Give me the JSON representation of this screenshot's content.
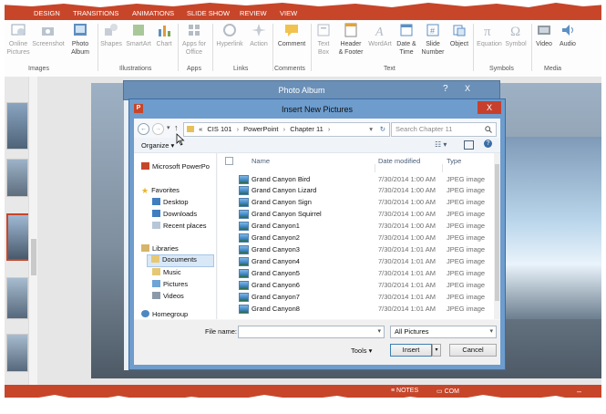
{
  "ribbon": {
    "tabs": [
      "DESIGN",
      "TRANSITIONS",
      "ANIMATIONS",
      "SLIDE SHOW",
      "REVIEW",
      "VIEW"
    ],
    "buttons": {
      "online_pictures": "Online\nPictures",
      "screenshot": "Screenshot",
      "photo_album": "Photo\nAlbum",
      "shapes": "Shapes",
      "smartart": "SmartArt",
      "chart": "Chart",
      "apps_for_office": "Apps for\nOffice",
      "hyperlink": "Hyperlink",
      "action": "Action",
      "comment": "Comment",
      "text_box": "Text\nBox",
      "header_footer": "Header\n& Footer",
      "wordart": "WordArt",
      "date_time": "Date &\nTime",
      "slide_number": "Slide\nNumber",
      "object": "Object",
      "equation": "Equation",
      "symbol": "Symbol",
      "video": "Video",
      "audio": "Audio"
    },
    "groups": {
      "images": "Images",
      "illustrations": "Illustrations",
      "apps": "Apps",
      "links": "Links",
      "comments": "Comments",
      "text": "Text",
      "symbols": "Symbols",
      "media": "Media"
    }
  },
  "status_bar": {
    "notes": "NOTES",
    "comments": "COM"
  },
  "photo_album": {
    "title": "Photo Album",
    "help": "?",
    "close": "X"
  },
  "insert_dialog": {
    "title": "Insert New Pictures",
    "close": "X",
    "breadcrumb": {
      "prefix": "«",
      "parts": [
        "CIS 101",
        "PowerPoint",
        "Chapter 11"
      ]
    },
    "search_placeholder": "Search Chapter 11",
    "organize": "Organize",
    "nav": {
      "microsoft_powerpoint": "Microsoft PowerPo",
      "favorites": "Favorites",
      "desktop": "Desktop",
      "downloads": "Downloads",
      "recent_places": "Recent places",
      "libraries": "Libraries",
      "documents": "Documents",
      "music": "Music",
      "pictures": "Pictures",
      "videos": "Videos",
      "homegroup": "Homegroup"
    },
    "columns": {
      "name": "Name",
      "date_modified": "Date modified",
      "type": "Type"
    },
    "files": [
      {
        "name": "Grand Canyon Bird",
        "date": "7/30/2014 1:00 AM",
        "type": "JPEG image"
      },
      {
        "name": "Grand Canyon Lizard",
        "date": "7/30/2014 1:00 AM",
        "type": "JPEG image"
      },
      {
        "name": "Grand Canyon Sign",
        "date": "7/30/2014 1:00 AM",
        "type": "JPEG image"
      },
      {
        "name": "Grand Canyon Squirrel",
        "date": "7/30/2014 1:00 AM",
        "type": "JPEG image"
      },
      {
        "name": "Grand Canyon1",
        "date": "7/30/2014 1:00 AM",
        "type": "JPEG image"
      },
      {
        "name": "Grand Canyon2",
        "date": "7/30/2014 1:00 AM",
        "type": "JPEG image"
      },
      {
        "name": "Grand Canyon3",
        "date": "7/30/2014 1:01 AM",
        "type": "JPEG image"
      },
      {
        "name": "Grand Canyon4",
        "date": "7/30/2014 1:01 AM",
        "type": "JPEG image"
      },
      {
        "name": "Grand Canyon5",
        "date": "7/30/2014 1:01 AM",
        "type": "JPEG image"
      },
      {
        "name": "Grand Canyon6",
        "date": "7/30/2014 1:01 AM",
        "type": "JPEG image"
      },
      {
        "name": "Grand Canyon7",
        "date": "7/30/2014 1:01 AM",
        "type": "JPEG image"
      },
      {
        "name": "Grand Canyon8",
        "date": "7/30/2014 1:01 AM",
        "type": "JPEG image"
      }
    ],
    "file_name_label": "File name:",
    "file_name_value": "",
    "file_type_filter": "All Pictures",
    "tools": "Tools",
    "insert": "Insert",
    "cancel": "Cancel"
  },
  "colors": {
    "accent": "#c7462a",
    "title_bar": "#6d9ccd",
    "link_blue": "#1a5fa8"
  }
}
